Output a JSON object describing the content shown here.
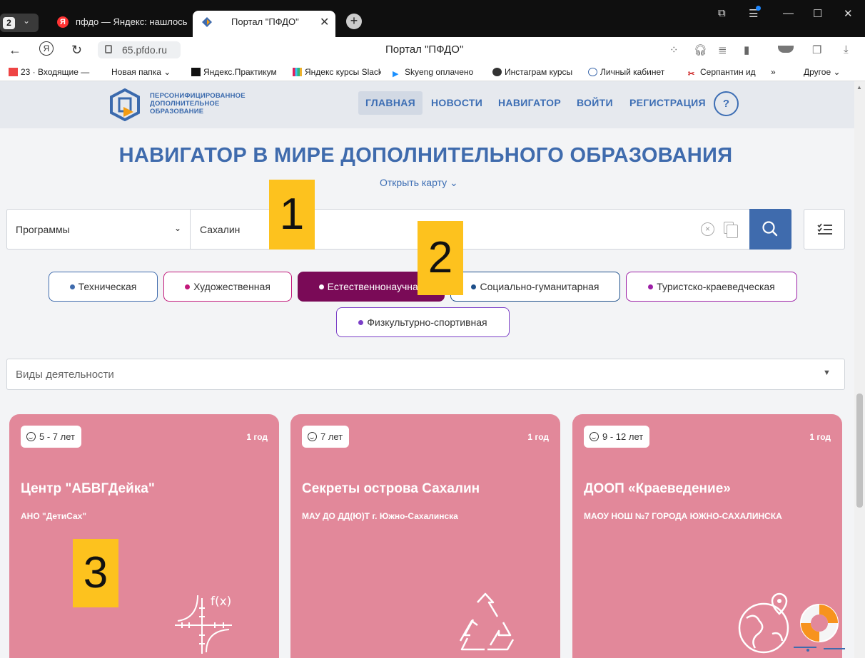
{
  "browser": {
    "tab_count": "2",
    "tabs": [
      {
        "label": "пфдо — Яндекс: нашлось"
      },
      {
        "label": "Портал \"ПФДО\""
      }
    ],
    "url": "65.pfdo.ru",
    "page_title": "Портал \"ПФДО\"",
    "bookmarks": [
      {
        "label": "23 · Входящие —"
      },
      {
        "label": "Новая папка"
      },
      {
        "label": "Яндекс.Практикум"
      },
      {
        "label": "Яндекс курсы Slack"
      },
      {
        "label": "Skyeng оплачено"
      },
      {
        "label": "Инстаграм курсы"
      },
      {
        "label": "Личный кабинет"
      },
      {
        "label": "Серпантин ид"
      },
      {
        "label": "»"
      },
      {
        "label": "Другое"
      }
    ]
  },
  "site": {
    "logo_lines": [
      "ПЕРСОНИФИЦИРОВАННОЕ",
      "ДОПОЛНИТЕЛЬНОЕ",
      "ОБРАЗОВАНИЕ"
    ],
    "menu": [
      "ГЛАВНАЯ",
      "НОВОСТИ",
      "НАВИГАТОР",
      "ВОЙТИ",
      "РЕГИСТРАЦИЯ"
    ],
    "help": "?",
    "title": "НАВИГАТОР В МИРЕ ДОПОЛНИТЕЛЬНОГО ОБРАЗОВАНИЯ",
    "open_map": "Открыть карту"
  },
  "search": {
    "type_value": "Программы",
    "query": "Сахалин"
  },
  "directions": [
    {
      "label": "Техническая",
      "color": "#3f6bad"
    },
    {
      "label": "Художественная",
      "color": "#c2187a"
    },
    {
      "label": "Естественнонаучная",
      "color": "#7a0a57",
      "active": true
    },
    {
      "label": "Социально-гуманитарная",
      "color": "#1d4f8a"
    },
    {
      "label": "Туристско-краеведческая",
      "color": "#9c1fa6"
    },
    {
      "label": "Физкультурно-спортивная",
      "color": "#7b3fc7"
    }
  ],
  "activity_placeholder": "Виды деятельности",
  "cards": [
    {
      "age": "5 - 7 лет",
      "duration": "1 год",
      "title": "Центр \"АБВГДейка\"",
      "org": "АНО \"ДетиСах\"",
      "icon": "function-graph-icon"
    },
    {
      "age": "7 лет",
      "duration": "1 год",
      "title": "Секреты острова Сахалин",
      "org": "МАУ ДО ДД(Ю)Т г. Южно-Сахалинска",
      "icon": "recycle-icon"
    },
    {
      "age": "9 - 12 лет",
      "duration": "1 год",
      "title": "ДООП «Краеведение»",
      "org": "МАОУ НОШ №7 ГОРОДА ЮЖНО-САХАЛИНСКА",
      "icon": "globe-pin-icon"
    }
  ],
  "markers": [
    "1",
    "2",
    "3"
  ]
}
